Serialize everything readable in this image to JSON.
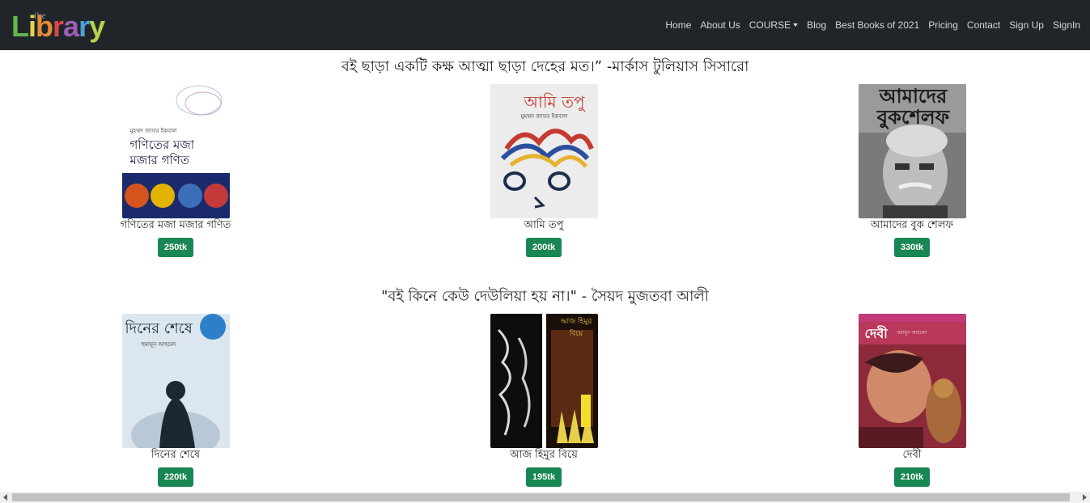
{
  "logo": {
    "small": "the",
    "letters": [
      "L",
      "i",
      "b",
      "r",
      "a",
      "r",
      "y"
    ]
  },
  "nav": {
    "items": [
      "Home",
      "About Us",
      "COURSE",
      "Blog",
      "Best Books of 2021",
      "Pricing",
      "Contact",
      "Sign Up",
      "SignIn"
    ]
  },
  "quotes": {
    "q1": "বই ছাড়া একটি কক্ষ আত্মা ছাড়া দেহের মত।” -মার্কাস টুলিয়াস সিসারো",
    "q2": "\"বই কিনে কেউ দেউলিয়া হয় না।\" - সৈয়দ মুজতবা আলী"
  },
  "row1": [
    {
      "title": "গণিতের মজা মজার গণিত",
      "price": "250tk",
      "cover_author": "মুহম্মদ জাফর ইকবাল",
      "cover_title": "গণিতের মজা মজার গণিত"
    },
    {
      "title": "আমি তপু",
      "price": "200tk",
      "cover_author": "মুহম্মদ জাফর ইকবাল",
      "cover_title": "আমি তপু"
    },
    {
      "title": "আমাদের বুক শেলফ",
      "price": "330tk",
      "cover_title": "আমাদের বুকশেলফ"
    }
  ],
  "row2": [
    {
      "title": "দিনের শেষে",
      "price": "220tk",
      "cover_author": "হুমায়ূন আহমেদ",
      "cover_title": "দিনের শেষে"
    },
    {
      "title": "আজ হিমুর বিয়ে",
      "price": "195tk",
      "cover_title": "আজ হিমুর বিয়ে"
    },
    {
      "title": "দেবী",
      "price": "210tk",
      "cover_author": "হুমায়ূন আহমেদ",
      "cover_title": "দেবী"
    }
  ],
  "colors": {
    "navbar": "#212529",
    "price_button": "#198754"
  }
}
